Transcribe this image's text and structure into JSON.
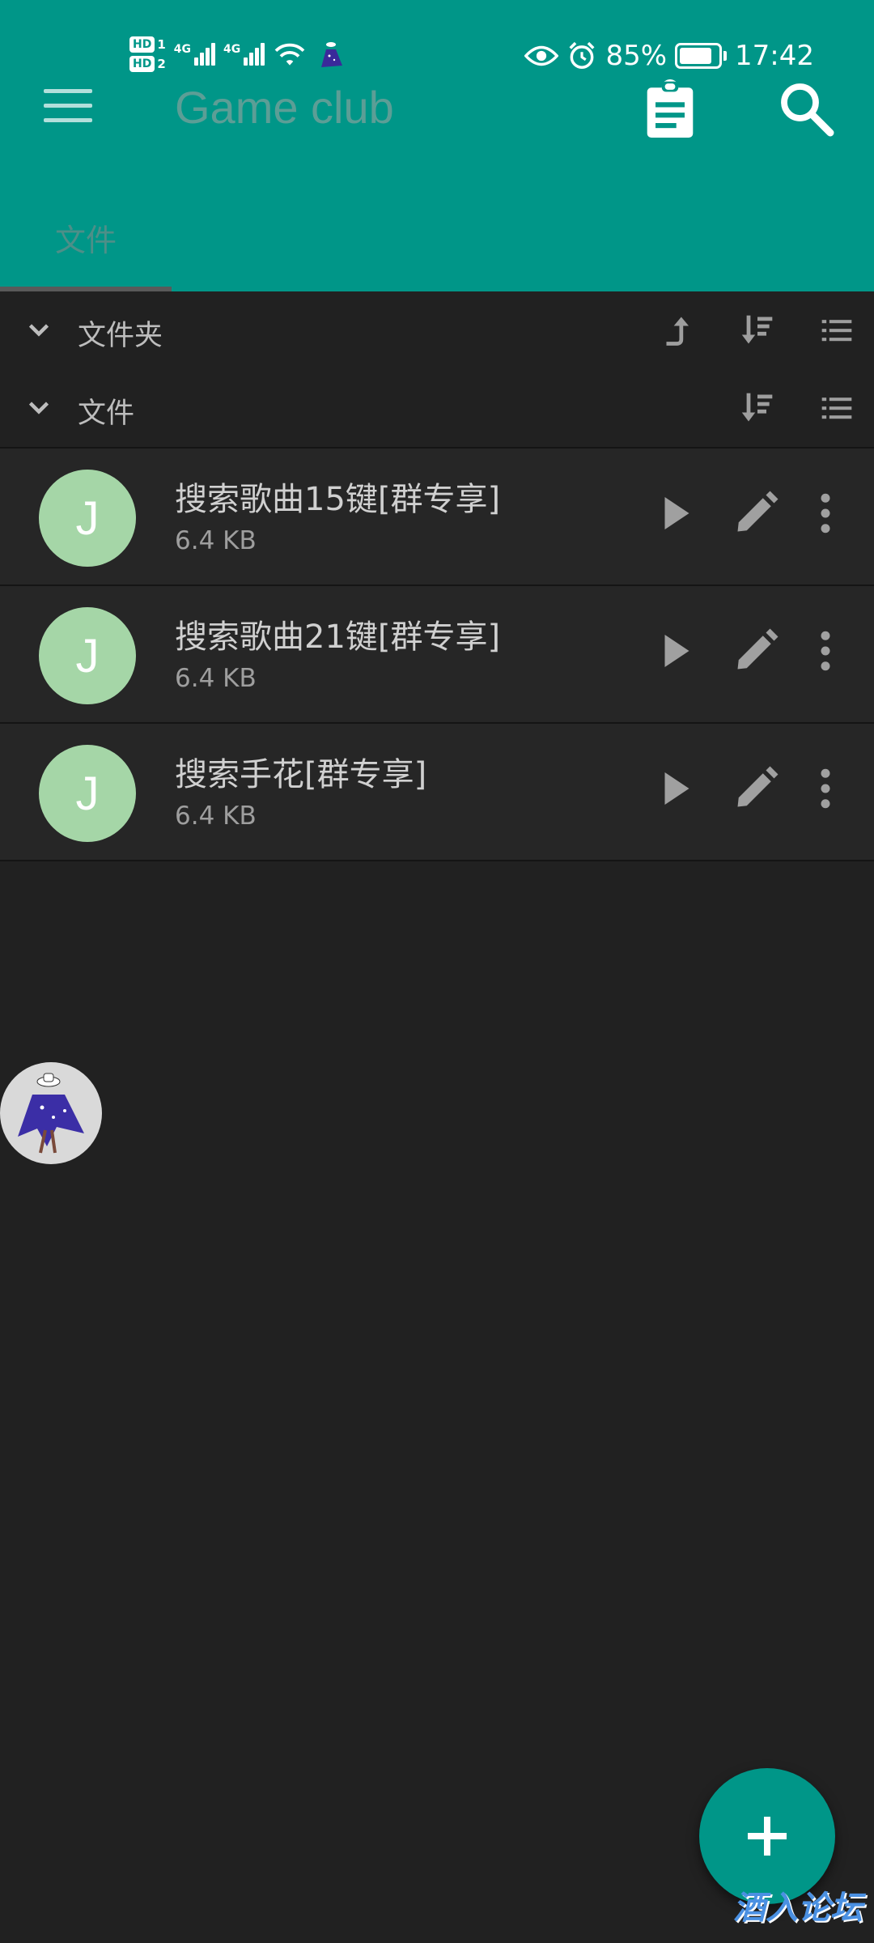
{
  "status_bar": {
    "sim1": "HD",
    "sim1_index": "1",
    "sim2": "HD",
    "sim2_index": "2",
    "net1": "4G",
    "net2": "4G",
    "battery_percent": "85%",
    "battery_level": 0.85,
    "time": "17:42"
  },
  "app_bar": {
    "title": "Game club",
    "tab_label": "文件"
  },
  "sections": {
    "folders_label": "文件夹",
    "files_label": "文件"
  },
  "files": [
    {
      "avatar_letter": "J",
      "name": "搜索歌曲15键[群专享]",
      "size": "6.4 KB"
    },
    {
      "avatar_letter": "J",
      "name": "搜索歌曲21键[群专享]",
      "size": "6.4 KB"
    },
    {
      "avatar_letter": "J",
      "name": "搜索手花[群专享]",
      "size": "6.4 KB"
    }
  ],
  "watermark": "酒入论坛",
  "colors": {
    "primary": "#009688",
    "background": "#212121",
    "avatar": "#a5d6a7"
  }
}
